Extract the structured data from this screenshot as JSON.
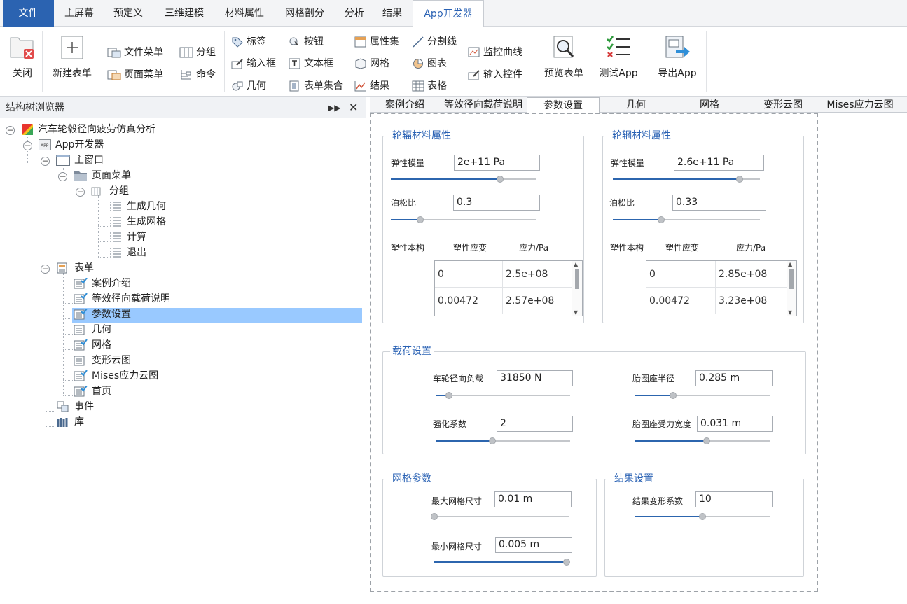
{
  "menu": {
    "file": "文件",
    "items": [
      "主屏幕",
      "预定义",
      "三维建模",
      "材料属性",
      "网格剖分",
      "分析",
      "结果"
    ],
    "active": "App开发器"
  },
  "ribbon": {
    "close": "关闭",
    "new_form": "新建表单",
    "file_menu": "文件菜单",
    "page_menu": "页面菜单",
    "group": "分组",
    "command": "命令",
    "label": "标签",
    "input_box": "输入框",
    "geometry": "几何",
    "button": "按钮",
    "text_box": "文本框",
    "form_set": "表单集合",
    "property_set": "属性集",
    "mesh": "网格",
    "result": "结果",
    "divider": "分割线",
    "chart": "图表",
    "table": "表格",
    "monitor_curve": "监控曲线",
    "input_control": "输入控件",
    "preview_form": "预览表单",
    "test_app": "测试App",
    "export_app": "导出App"
  },
  "left_panel": {
    "title": "结构树浏览器",
    "tree": {
      "root": "汽车轮毂径向疲劳仿真分析",
      "app_dev": "App开发器",
      "main_window": "主窗口",
      "page_menu": "页面菜单",
      "group": "分组",
      "group_items": [
        "生成几何",
        "生成网格",
        "计算",
        "退出"
      ],
      "forms": "表单",
      "form_items": [
        "案例介绍",
        "等效径向载荷说明",
        "参数设置",
        "几何",
        "网格",
        "变形云图",
        "Mises应力云图",
        "首页"
      ],
      "events": "事件",
      "library": "库"
    }
  },
  "tabs": [
    "案例介绍",
    "等效径向载荷说明",
    "参数设置",
    "几何",
    "网格",
    "变形云图",
    "Mises应力云图"
  ],
  "active_tab": "参数设置",
  "form": {
    "spoke": {
      "title": "轮辐材料属性",
      "elastic_label": "弹性模量",
      "elastic_value": "2e+11 Pa",
      "elastic_slider": 0.75,
      "poisson_label": "泊松比",
      "poisson_value": "0.3",
      "poisson_slider": 0.2,
      "plastic_label": "塑性本构",
      "col_strain": "塑性应变",
      "col_stress": "应力/Pa",
      "rows": [
        [
          "0",
          "2.5e+08"
        ],
        [
          "0.00472",
          "2.57e+08"
        ]
      ]
    },
    "rim": {
      "title": "轮辋材料属性",
      "elastic_label": "弹性模量",
      "elastic_value": "2.6e+11 Pa",
      "elastic_slider": 0.86,
      "poisson_label": "泊松比",
      "poisson_value": "0.33",
      "poisson_slider": 0.33,
      "plastic_label": "塑性本构",
      "col_strain": "塑性应变",
      "col_stress": "应力/Pa",
      "rows": [
        [
          "0",
          "2.85e+08"
        ],
        [
          "0.00472",
          "3.23e+08"
        ]
      ]
    },
    "load": {
      "title": "载荷设置",
      "radial_label": "车轮径向负载",
      "radial_value": "31850 N",
      "radial_slider": 0.1,
      "radius_label": "胎圈座半径",
      "radius_value": "0.285 m",
      "radius_slider": 0.28,
      "factor_label": "强化系数",
      "factor_value": "2",
      "factor_slider": 0.42,
      "width_label": "胎圈座受力宽度",
      "width_value": "0.031 m",
      "width_slider": 0.53
    },
    "mesh": {
      "title": "网格参数",
      "max_label": "最大网格尺寸",
      "max_value": "0.01 m",
      "max_slider": 0.0,
      "min_label": "最小网格尺寸",
      "min_value": "0.005 m",
      "min_slider": 1.0
    },
    "result": {
      "title": "结果设置",
      "scale_label": "结果变形系数",
      "scale_value": "10",
      "scale_slider": 0.5
    }
  },
  "colors": {
    "accent": "#2b63b1",
    "selection": "#99c9ff",
    "slider_fill": "#2c65ae"
  }
}
